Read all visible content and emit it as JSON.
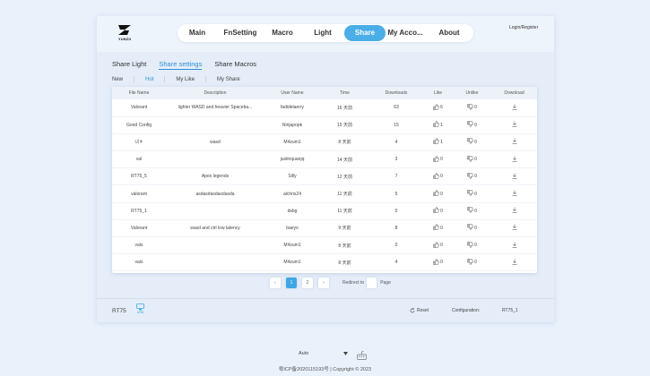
{
  "logo": {
    "text": "YUNZII"
  },
  "nav": {
    "items": [
      "Main",
      "FnSetting",
      "Macro",
      "Light",
      "Share",
      "My Acco...",
      "About"
    ],
    "active_index": 4
  },
  "login": "Login/Register",
  "share_tabs": {
    "items": [
      "Share Light",
      "Share settings",
      "Share Macros"
    ],
    "active_index": 1
  },
  "sub_tabs": {
    "items": [
      "New",
      "Hot",
      "My Like",
      "My Share"
    ],
    "active_index": 1
  },
  "table": {
    "headers": [
      "File Name",
      "Description",
      "User Name",
      "Time",
      "Downloads",
      "Like",
      "Unlike",
      "Download"
    ],
    "rows": [
      {
        "file": "Valorant",
        "desc": "lighter WASD and heavier Spaceba...",
        "user": "fadidelaerry",
        "time": "16 天前",
        "downloads": "63",
        "like": "6",
        "unlike": "0"
      },
      {
        "file": "Good Config",
        "desc": "",
        "user": "Ninjapopk",
        "time": "15 天前",
        "downloads": "15",
        "like": "1",
        "unlike": "0"
      },
      {
        "file": "녀ㅎ",
        "desc": "wasd",
        "user": "M4zum1",
        "time": "8 天前",
        "downloads": "4",
        "like": "1",
        "unlike": "0"
      },
      {
        "file": "val",
        "desc": "",
        "user": "justinquanjq",
        "time": "14 天前",
        "downloads": "3",
        "like": "0",
        "unlike": "0"
      },
      {
        "file": "RT75_5",
        "desc": "Apex legends",
        "user": "Silly",
        "time": "12 天前",
        "downloads": "7",
        "like": "0",
        "unlike": "0"
      },
      {
        "file": "valorant",
        "desc": "asdasdasdasdasda",
        "user": "alchris24",
        "time": "11 天前",
        "downloads": "5",
        "like": "0",
        "unlike": "0"
      },
      {
        "file": "RT75_1",
        "desc": "",
        "user": "dsbg",
        "time": "11 天前",
        "downloads": "0",
        "like": "0",
        "unlike": "0"
      },
      {
        "file": "Valorant",
        "desc": "wasd and ctrl low latency",
        "user": "baeyo",
        "time": "9 天前",
        "downloads": "8",
        "like": "0",
        "unlike": "0"
      },
      {
        "file": "vals",
        "desc": "",
        "user": "M4zum1",
        "time": "8 天前",
        "downloads": "0",
        "like": "0",
        "unlike": "0"
      },
      {
        "file": "vals",
        "desc": "",
        "user": "M4zum1",
        "time": "8 天前",
        "downloads": "4",
        "like": "0",
        "unlike": "0"
      }
    ]
  },
  "pagination": {
    "prev": "‹",
    "next": "›",
    "pages": [
      "1",
      "2"
    ],
    "current_page": "1",
    "redirect_label": "Redirect to",
    "page_label": "Page"
  },
  "bottom_bar": {
    "device": "RT75",
    "usb_label": "USB",
    "reset": "Reset",
    "configuration_label": "Configuration:",
    "configuration_value": "RT75_1"
  },
  "language": {
    "selected": "Auto"
  },
  "copyright": "粤ICP备2020115193号 | Copyright © 2023",
  "colors": {
    "accent": "#4aaee8",
    "background": "#e9f1fb"
  }
}
